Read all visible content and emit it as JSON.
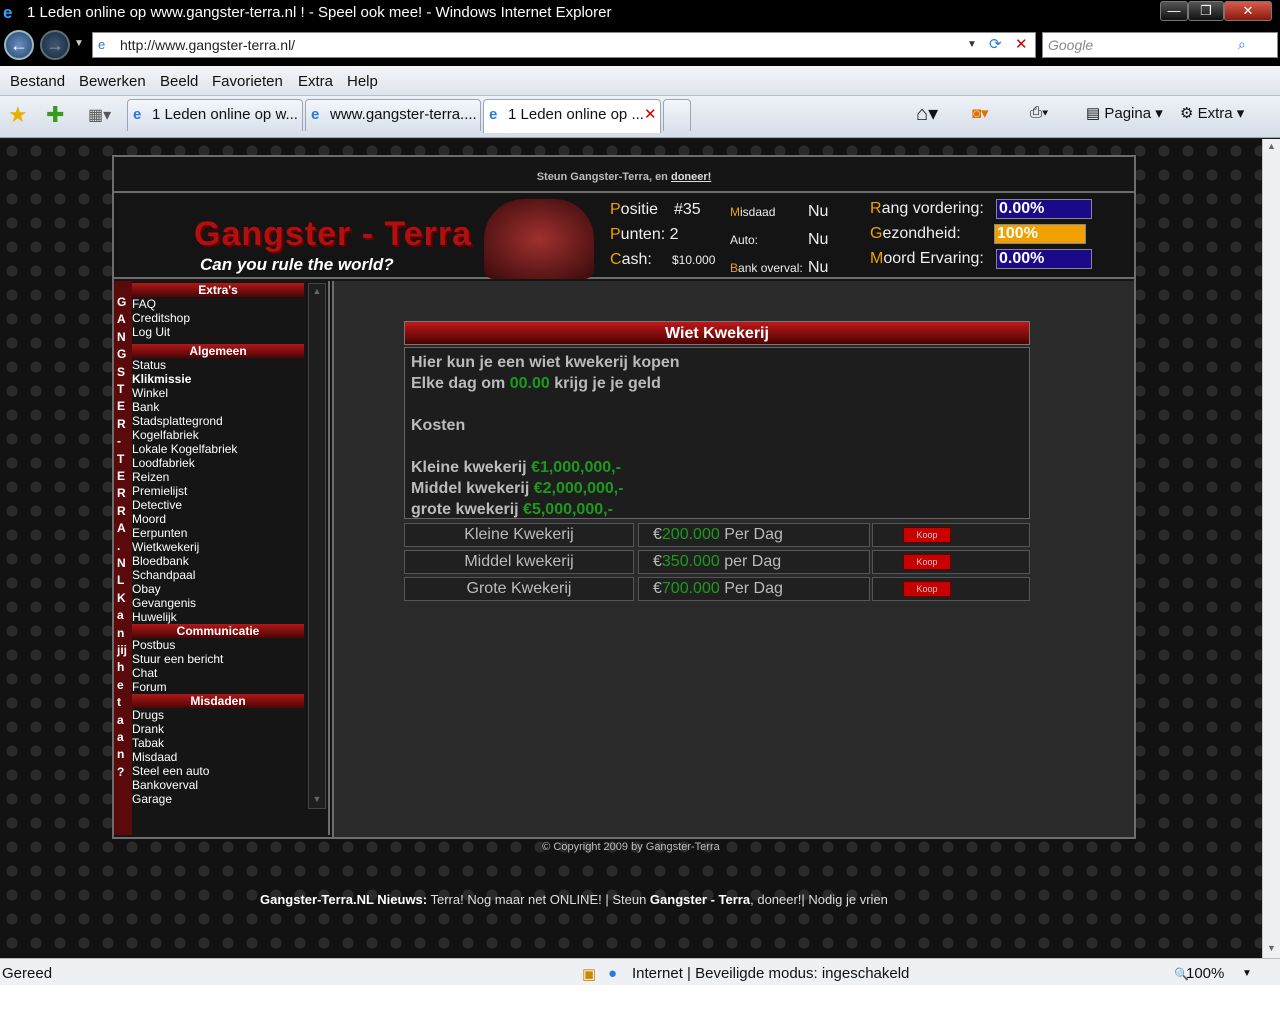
{
  "window": {
    "title": "1 Leden online op www.gangster-terra.nl ! - Speel ook mee! - Windows Internet Explorer",
    "min": "—",
    "max": "❐",
    "close": "✕"
  },
  "address": {
    "url": "http://www.gangster-terra.nl/",
    "search_placeholder": "Google"
  },
  "menu": [
    "Bestand",
    "Bewerken",
    "Beeld",
    "Favorieten",
    "Extra",
    "Help"
  ],
  "tabs": [
    "1 Leden online op w...",
    "www.gangster-terra....",
    "1 Leden online op ..."
  ],
  "toolbar": {
    "pagina": "Pagina",
    "extra": "Extra"
  },
  "site": {
    "donate_text": "Steun Gangster-Terra, en ",
    "donate_link": "doneer!",
    "logo": "Gangster - Terra",
    "slogan": "Can you rule the world?",
    "stats": {
      "positie_label": "ositie",
      "positie_value": "#35",
      "punten_label": "unten: 2",
      "cash_label": "ash:",
      "cash_value": "$10.000",
      "misdaad_label": "isdaad",
      "misdaad_value": "Nu",
      "auto_label": "Auto:",
      "auto_value": "Nu",
      "bank_label": "ank overval:",
      "bank_value": "Nu",
      "rang_label": "ang vordering:",
      "rang_value": "0.00%",
      "gezondheid_label": "ezondheid:",
      "gezondheid_value": "100%",
      "moord_label": "oord Ervaring:",
      "moord_value": "0.00%"
    },
    "strip": [
      "G",
      "A",
      "N",
      "G",
      "S",
      "T",
      "E",
      "R",
      "-",
      "T",
      "E",
      "R",
      "R",
      "A",
      ".",
      "N",
      "L",
      "K",
      "a",
      "n",
      "jij",
      "h",
      "e",
      "t",
      "a",
      "a",
      "n",
      "?"
    ],
    "sidebar": {
      "extras": "Extra's",
      "extras_items": [
        "FAQ",
        "Creditshop",
        "Log Uit"
      ],
      "algemeen": "Algemeen",
      "algemeen_items": [
        "Status",
        "Klikmissie",
        "Winkel",
        "Bank",
        "Stadsplattegrond",
        "Kogelfabriek",
        "Lokale Kogelfabriek",
        "Loodfabriek",
        "Reizen",
        "Premielijst",
        "Detective",
        "Moord",
        "Eerpunten",
        "Wietkwekerij",
        "Bloedbank",
        "Schandpaal",
        "Obay",
        "Gevangenis",
        "Huwelijk"
      ],
      "communicatie": "Communicatie",
      "communicatie_items": [
        "Postbus",
        "Stuur een bericht",
        "Chat",
        "Forum"
      ],
      "misdaden": "Misdaden",
      "misdaden_items": [
        "Drugs",
        "Drank",
        "Tabak",
        "Misdaad",
        "Steel een auto",
        "Bankoverval",
        "Garage"
      ]
    },
    "panel": {
      "title": "Wiet Kwekerij",
      "line1": "Hier kun je een wiet kwekerij kopen",
      "line2_a": "Elke dag om ",
      "line2_time": "00.00",
      "line2_b": " krijg je je geld",
      "kosten": "Kosten",
      "costs": [
        {
          "label": "Kleine kwekerij ",
          "price": "€1,000,000,-"
        },
        {
          "label": "Middel kwekerij ",
          "price": "€2,000,000,-"
        },
        {
          "label": "grote kwekerij ",
          "price": "€5,000,000,-"
        }
      ]
    },
    "rows": [
      {
        "name": "Kleine Kwekerij",
        "amount": "200.000",
        "per": " Per Dag",
        "btn": "Koop"
      },
      {
        "name": "Middel kwekerij",
        "amount": "350.000",
        "per": " per Dag",
        "btn": "Koop"
      },
      {
        "name": "Grote Kwekerij",
        "amount": "700.000",
        "per": " Per Dag",
        "btn": "Koop"
      }
    ],
    "copyright": "© Copyright 2009 by Gangster-Terra",
    "news": {
      "label": "Gangster-Terra.NL Nieuws:",
      "text1": " Terra! Nog maar net ONLINE! | Steun ",
      "brand": "Gangster - Terra",
      "text2": ", doneer!| Nodig je vrien"
    }
  },
  "status": {
    "left": "Gereed",
    "zone": "Internet | Beveiligde modus: ingeschakeld",
    "zoom": "100%"
  }
}
